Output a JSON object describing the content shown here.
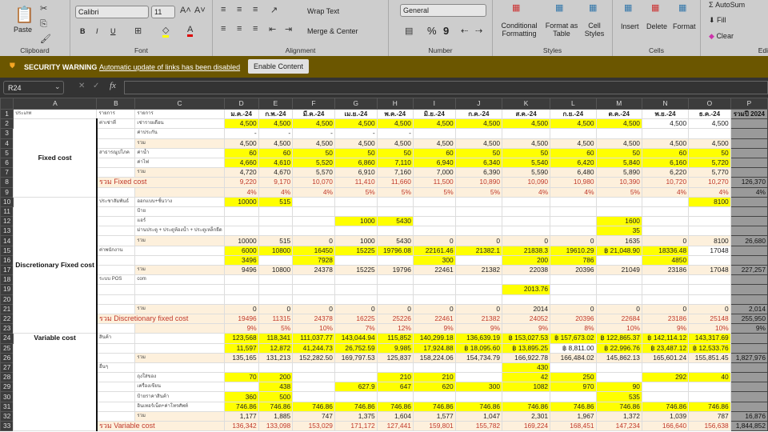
{
  "ribbon": {
    "clipboard": {
      "paste": "Paste",
      "label": "Clipboard"
    },
    "font": {
      "name": "Calibri",
      "size": "11",
      "bold": "B",
      "italic": "I",
      "underline": "U",
      "label": "Font"
    },
    "alignment": {
      "wrap": "Wrap Text",
      "merge": "Merge & Center",
      "label": "Alignment"
    },
    "number": {
      "format": "General",
      "percent": "%",
      "comma": "9",
      "label": "Number"
    },
    "styles": {
      "conditional": "Conditional Formatting",
      "format_table": "Format as Table",
      "cell_styles": "Cell Styles",
      "label": "Styles"
    },
    "cells": {
      "insert": "Insert",
      "delete": "Delete",
      "format": "Format",
      "label": "Cells"
    },
    "editing": {
      "autosum": "AutoSum",
      "fill": "Fill",
      "clear": "Clear",
      "label": "Edi"
    }
  },
  "security": {
    "title": "SECURITY WARNING",
    "message": "Automatic update of links has been disabled",
    "button": "Enable Content"
  },
  "formula_bar": {
    "name_box": "R24",
    "fx": "fx",
    "value": ""
  },
  "columns": [
    "A",
    "B",
    "C",
    "D",
    "E",
    "F",
    "G",
    "H",
    "I",
    "J",
    "K",
    "L",
    "M",
    "N",
    "O",
    "P"
  ],
  "header_row": {
    "a": "ประเภท",
    "b": "รายการ",
    "c": "รายการ",
    "months": [
      "ม.ค.-24",
      "ก.พ.-24",
      "มี.ค.-24",
      "เม.ย.-24",
      "พ.ค.-24",
      "มิ.ย.-24",
      "ก.ค.-24",
      "ส.ค.-24",
      "ก.ย.-24",
      "ต.ค.-24",
      "พ.ย.-24",
      "ธ.ค.-24"
    ],
    "p": "รวมปี 2024"
  },
  "groups": [
    {
      "label": "Fixed cost",
      "from": 2,
      "to": 9
    },
    {
      "label": "Discretionary Fixed cost",
      "from": 10,
      "to": 23
    },
    {
      "label": "Variable cost",
      "from": 24,
      "to": 33
    }
  ],
  "rows": [
    {
      "n": 2,
      "b": "ค่าเช่าที่",
      "c": "เช่ารายเดือน",
      "v": [
        "4,500",
        "4,500",
        "4,500",
        "4,500",
        "4,500",
        "4,500",
        "4,500",
        "4,500",
        "4,500",
        "4,500",
        "4,500",
        "4,500"
      ],
      "yellow": "DEFGHIJKLM"
    },
    {
      "n": 3,
      "c": "ค่าประกัน",
      "v": [
        "-",
        "-",
        "-",
        "-",
        "-",
        "",
        "",
        "",
        "",
        "",
        "",
        ""
      ]
    },
    {
      "n": 4,
      "c": "รวม",
      "v": [
        "4,500",
        "4,500",
        "4,500",
        "4,500",
        "4,500",
        "4,500",
        "4,500",
        "4,500",
        "4,500",
        "4,500",
        "4,500",
        "4,500"
      ],
      "total": true
    },
    {
      "n": 5,
      "b": "สาธารณูปโภค",
      "c": "ค่าน้ำ",
      "v": [
        "60",
        "60",
        "50",
        "50",
        "50",
        "60",
        "50",
        "50",
        "60",
        "50",
        "60",
        "50"
      ],
      "yellow": "DEFGHIJKLMNO"
    },
    {
      "n": 6,
      "c": "ค่าไฟ",
      "v": [
        "4,660",
        "4,610",
        "5,520",
        "6,860",
        "7,110",
        "6,940",
        "6,340",
        "5,540",
        "6,420",
        "5,840",
        "6,160",
        "5,720"
      ],
      "yellow": "DEFGHIJKLMNO"
    },
    {
      "n": 7,
      "c": "รวม",
      "v": [
        "4,720",
        "4,670",
        "5,570",
        "6,910",
        "7,160",
        "7,000",
        "6,390",
        "5,590",
        "6,480",
        "5,890",
        "6,220",
        "5,770"
      ],
      "total": true
    },
    {
      "n": 8,
      "b": "รวม Fixed cost",
      "v": [
        "9,220",
        "9,170",
        "10,070",
        "11,410",
        "11,660",
        "11,500",
        "10,890",
        "10,090",
        "10,980",
        "10,390",
        "10,720",
        "10,270"
      ],
      "p": "126,370",
      "total": true,
      "red": true
    },
    {
      "n": 9,
      "v": [
        "4%",
        "4%",
        "4%",
        "5%",
        "5%",
        "5%",
        "5%",
        "4%",
        "4%",
        "5%",
        "4%",
        "4%"
      ],
      "p": "4%",
      "total": true,
      "red": true
    },
    {
      "n": 10,
      "b": "ประชาสัมพันธ์",
      "c": "ออกแบบ+ชั้นวาง",
      "v": [
        "10000",
        "515",
        "",
        "",
        "",
        "",
        "",
        "",
        "",
        "",
        "",
        "8100"
      ],
      "yellow": "DEO"
    },
    {
      "n": 11,
      "c": "ป้าย",
      "v": [
        "",
        "",
        "",
        "",
        "",
        "",
        "",
        "",
        "",
        "",
        "",
        ""
      ]
    },
    {
      "n": 12,
      "c": "แอร์",
      "v": [
        "",
        "",
        "",
        "1000",
        "5430",
        "",
        "",
        "",
        "",
        "1600",
        "",
        ""
      ],
      "yellow": "GHM"
    },
    {
      "n": 13,
      "c": "ม่านประตู + ประตูห้องน้ำ + ประตูเหล็กยืด",
      "v": [
        "",
        "",
        "",
        "",
        "",
        "",
        "",
        "",
        "",
        "35",
        "",
        ""
      ],
      "yellow": "M"
    },
    {
      "n": 14,
      "c": "รวม",
      "v": [
        "10000",
        "515",
        "0",
        "1000",
        "5430",
        "0",
        "0",
        "0",
        "0",
        "1635",
        "0",
        "8100"
      ],
      "p": "26,680",
      "total": true
    },
    {
      "n": 15,
      "b": "ค่าพนักงาน",
      "v": [
        "6000",
        "10800",
        "16450",
        "15225",
        "19796.08",
        "22161.46",
        "21382.1",
        "21838.3",
        "19610.29",
        "฿ 21,048.90",
        "18336.48",
        "17048"
      ],
      "yellow": "DEFGHIJKLMN"
    },
    {
      "n": 16,
      "v": [
        "3496",
        "",
        "7928",
        "",
        "",
        "300",
        "",
        "200",
        "786",
        "",
        "4850",
        ""
      ],
      "yellow": "DFIKLN"
    },
    {
      "n": 17,
      "c": "รวม",
      "v": [
        "9496",
        "10800",
        "24378",
        "15225",
        "19796",
        "22461",
        "21382",
        "22038",
        "20396",
        "21049",
        "23186",
        "17048"
      ],
      "p": "227,257",
      "total": true
    },
    {
      "n": 18,
      "b": "ระบบ POS",
      "c": "com",
      "v": [
        "",
        "",
        "",
        "",
        "",
        "",
        "",
        "",
        "",
        "",
        "",
        ""
      ]
    },
    {
      "n": 19,
      "v": [
        "",
        "",
        "",
        "",
        "",
        "",
        "",
        "2013.76",
        "",
        "",
        "",
        ""
      ],
      "yellow": "K"
    },
    {
      "n": 20,
      "v": [
        "",
        "",
        "",
        "",
        "",
        "",
        "",
        "",
        "",
        "",
        "",
        ""
      ]
    },
    {
      "n": 21,
      "c": "รวม",
      "v": [
        "0",
        "0",
        "0",
        "0",
        "0",
        "0",
        "0",
        "2014",
        "0",
        "0",
        "0",
        "0"
      ],
      "p": "2,014",
      "total": true
    },
    {
      "n": 22,
      "b": "รวม Discretionary fixed cost",
      "v": [
        "19496",
        "11315",
        "24378",
        "16225",
        "25226",
        "22461",
        "21382",
        "24052",
        "20396",
        "22684",
        "23186",
        "25148"
      ],
      "p": "255,950",
      "total": true,
      "red": true
    },
    {
      "n": 23,
      "v": [
        "9%",
        "5%",
        "10%",
        "7%",
        "12%",
        "9%",
        "9%",
        "9%",
        "8%",
        "10%",
        "9%",
        "10%"
      ],
      "p": "9%",
      "total": true,
      "red": true
    },
    {
      "n": 24,
      "b": "สินค้า",
      "v": [
        "123,568",
        "118,341",
        "111,037.77",
        "143,044.94",
        "115,852",
        "140,299.18",
        "136,639.19",
        "฿ 153,027.53",
        "฿ 157,673.02",
        "฿ 122,865.37",
        "฿ 142,114.12",
        "143,317.69"
      ],
      "yellow": "DEFGHIJKLMNO"
    },
    {
      "n": 25,
      "v": [
        "11,597",
        "12,872",
        "41,244.73",
        "26,752.59",
        "9,985",
        "17,924.88",
        "฿ 18,095.60",
        "฿ 13,895.25",
        "฿ 8,811.00",
        "฿ 22,996.76",
        "฿ 23,487.12",
        "฿ 12,533.76"
      ],
      "yellow": "DEFGHIJKMNO"
    },
    {
      "n": 26,
      "c": "รวม",
      "v": [
        "135,165",
        "131,213",
        "152,282.50",
        "169,797.53",
        "125,837",
        "158,224.06",
        "154,734.79",
        "166,922.78",
        "166,484.02",
        "145,862.13",
        "165,601.24",
        "155,851.45"
      ],
      "p": "1,827,976",
      "total": true
    },
    {
      "n": 27,
      "b": "อื่นๆ",
      "v": [
        "",
        "",
        "",
        "",
        "",
        "",
        "",
        "430",
        "",
        "",
        "",
        ""
      ],
      "yellow": "K"
    },
    {
      "n": 28,
      "c": "ถุงใส่ของ",
      "v": [
        "70",
        "200",
        "",
        "",
        "210",
        "210",
        "",
        "42",
        "250",
        "",
        "292",
        "40"
      ],
      "yellow": "DEHIKLNO"
    },
    {
      "n": 29,
      "c": "เครื่องเขียน",
      "v": [
        "",
        "438",
        "",
        "627.9",
        "647",
        "620",
        "300",
        "1082",
        "970",
        "90",
        "",
        ""
      ],
      "yellow": "EGHIJKLM"
    },
    {
      "n": 30,
      "c": "ป้ายราคาสินค้า",
      "v": [
        "360",
        "500",
        "",
        "",
        "",
        "",
        "",
        "",
        "",
        "535",
        "",
        ""
      ],
      "yellow": "DEM"
    },
    {
      "n": 31,
      "c": "อินเทอร์เน็ต+ค่าโทรศัพท์",
      "v": [
        "746.86",
        "746.86",
        "746.86",
        "746.86",
        "746.86",
        "746.86",
        "746.86",
        "746.86",
        "746.86",
        "746.86",
        "746.86",
        "746.86"
      ],
      "yellow": "DEFGHIJKLMNO"
    },
    {
      "n": 32,
      "c": "รวม",
      "v": [
        "1,177",
        "1,885",
        "747",
        "1,375",
        "1,604",
        "1,577",
        "1,047",
        "2,301",
        "1,967",
        "1,372",
        "1,039",
        "787"
      ],
      "p": "16,876",
      "total": true
    },
    {
      "n": 33,
      "b": "รวม Variable cost",
      "v": [
        "136,342",
        "133,098",
        "153,029",
        "171,172",
        "127,441",
        "159,801",
        "155,782",
        "169,224",
        "168,451",
        "147,234",
        "166,640",
        "156,638"
      ],
      "p": "1,844,852",
      "total": true,
      "red": true
    }
  ]
}
